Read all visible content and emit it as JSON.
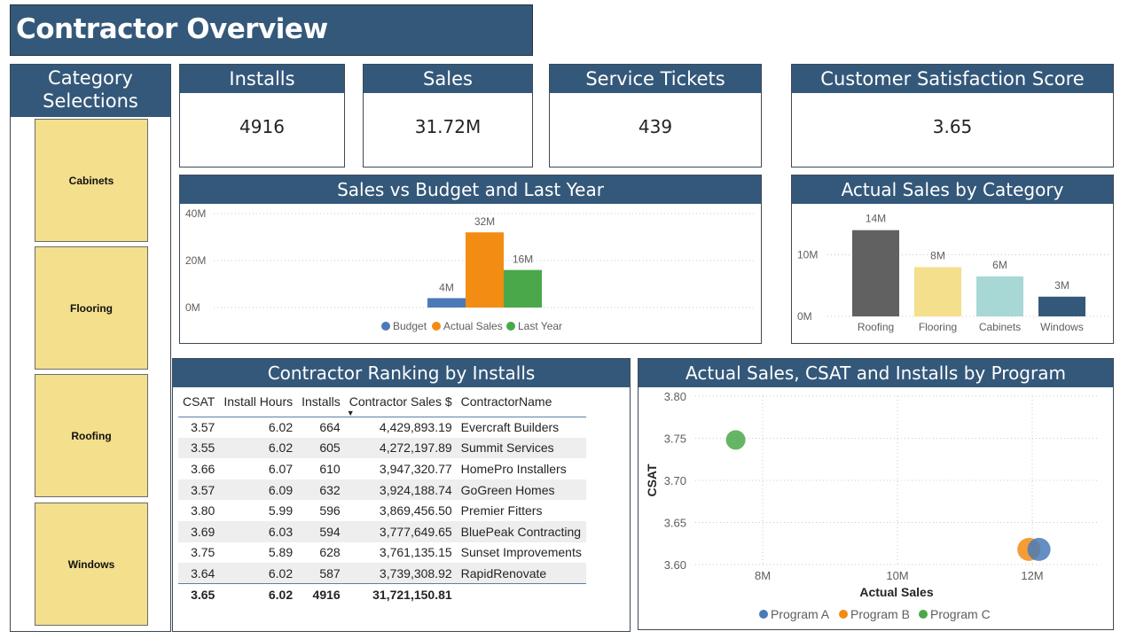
{
  "page_title": "Contractor Overview",
  "slicer": {
    "title_line1": "Category",
    "title_line2": "Selections",
    "items": [
      "Cabinets",
      "Flooring",
      "Roofing",
      "Windows"
    ]
  },
  "kpis": {
    "installs": {
      "title": "Installs",
      "value": "4916"
    },
    "sales": {
      "title": "Sales",
      "value": "31.72M"
    },
    "service_tickets": {
      "title": "Service Tickets",
      "value": "439"
    },
    "csat": {
      "title": "Customer Satisfaction Score",
      "value": "3.65"
    }
  },
  "colors": {
    "header": "#34587a",
    "budget": "#4a7ab8",
    "actual": "#f28c13",
    "last_year": "#4aa84a",
    "roofing": "#616161",
    "flooring": "#f3df8c",
    "cabinets": "#a8d8d5",
    "windows": "#34587a",
    "program_a": "#4a7ab8",
    "program_b": "#f28c13",
    "program_c": "#4aa84a"
  },
  "chart_data": [
    {
      "id": "sales_vs_budget",
      "type": "bar",
      "title": "Sales vs Budget and Last Year",
      "categories": [
        "Budget",
        "Actual Sales",
        "Last Year"
      ],
      "values": [
        4,
        32,
        16
      ],
      "value_labels": [
        "4M",
        "32M",
        "16M"
      ],
      "yticks": [
        {
          "v": 0,
          "label": "0M"
        },
        {
          "v": 20,
          "label": "20M"
        },
        {
          "v": 40,
          "label": "40M"
        }
      ],
      "ylim": [
        0,
        40
      ],
      "legend": [
        "Budget",
        "Actual Sales",
        "Last Year"
      ],
      "legend_position": "bottom-center",
      "grid": true
    },
    {
      "id": "sales_by_category",
      "type": "bar",
      "title": "Actual Sales by Category",
      "categories": [
        "Roofing",
        "Flooring",
        "Cabinets",
        "Windows"
      ],
      "values": [
        14,
        8,
        6.5,
        3.2
      ],
      "value_labels": [
        "14M",
        "8M",
        "6M",
        "3M"
      ],
      "yticks": [
        {
          "v": 0,
          "label": "0M"
        },
        {
          "v": 10,
          "label": "10M"
        }
      ],
      "ylim": [
        0,
        16
      ],
      "grid": true
    },
    {
      "id": "program_scatter",
      "type": "scatter",
      "title": "Actual Sales, CSAT and Installs by Program",
      "xlabel": "Actual Sales",
      "ylabel": "CSAT",
      "xlim": [
        7,
        13
      ],
      "ylim": [
        3.6,
        3.8
      ],
      "xticks": [
        {
          "v": 8,
          "label": "8M"
        },
        {
          "v": 10,
          "label": "10M"
        },
        {
          "v": 12,
          "label": "12M"
        }
      ],
      "yticks": [
        {
          "v": 3.6,
          "label": "3.60"
        },
        {
          "v": 3.65,
          "label": "3.65"
        },
        {
          "v": 3.7,
          "label": "3.70"
        },
        {
          "v": 3.75,
          "label": "3.75"
        },
        {
          "v": 3.8,
          "label": "3.80"
        }
      ],
      "series": [
        {
          "name": "Program A",
          "x": 12.1,
          "y": 3.618
        },
        {
          "name": "Program B",
          "x": 11.95,
          "y": 3.618
        },
        {
          "name": "Program C",
          "x": 7.6,
          "y": 3.748
        }
      ],
      "legend_position": "bottom-center",
      "grid": true
    }
  ],
  "ranking": {
    "title": "Contractor Ranking by Installs",
    "columns": [
      "CSAT",
      "Install Hours",
      "Installs",
      "Contractor Sales $",
      "ContractorName"
    ],
    "rows": [
      [
        "3.57",
        "6.02",
        "664",
        "4,429,893.19",
        "Evercraft Builders"
      ],
      [
        "3.55",
        "6.02",
        "605",
        "4,272,197.89",
        "Summit Services"
      ],
      [
        "3.66",
        "6.07",
        "610",
        "3,947,320.77",
        "HomePro Installers"
      ],
      [
        "3.57",
        "6.09",
        "632",
        "3,924,188.74",
        "GoGreen Homes"
      ],
      [
        "3.80",
        "5.99",
        "596",
        "3,869,456.50",
        "Premier Fitters"
      ],
      [
        "3.69",
        "6.03",
        "594",
        "3,777,649.65",
        "BluePeak Contracting"
      ],
      [
        "3.75",
        "5.89",
        "628",
        "3,761,135.15",
        "Sunset Improvements"
      ],
      [
        "3.64",
        "6.02",
        "587",
        "3,739,308.92",
        "RapidRenovate"
      ]
    ],
    "total": [
      "3.65",
      "6.02",
      "4916",
      "31,721,150.81",
      ""
    ]
  }
}
